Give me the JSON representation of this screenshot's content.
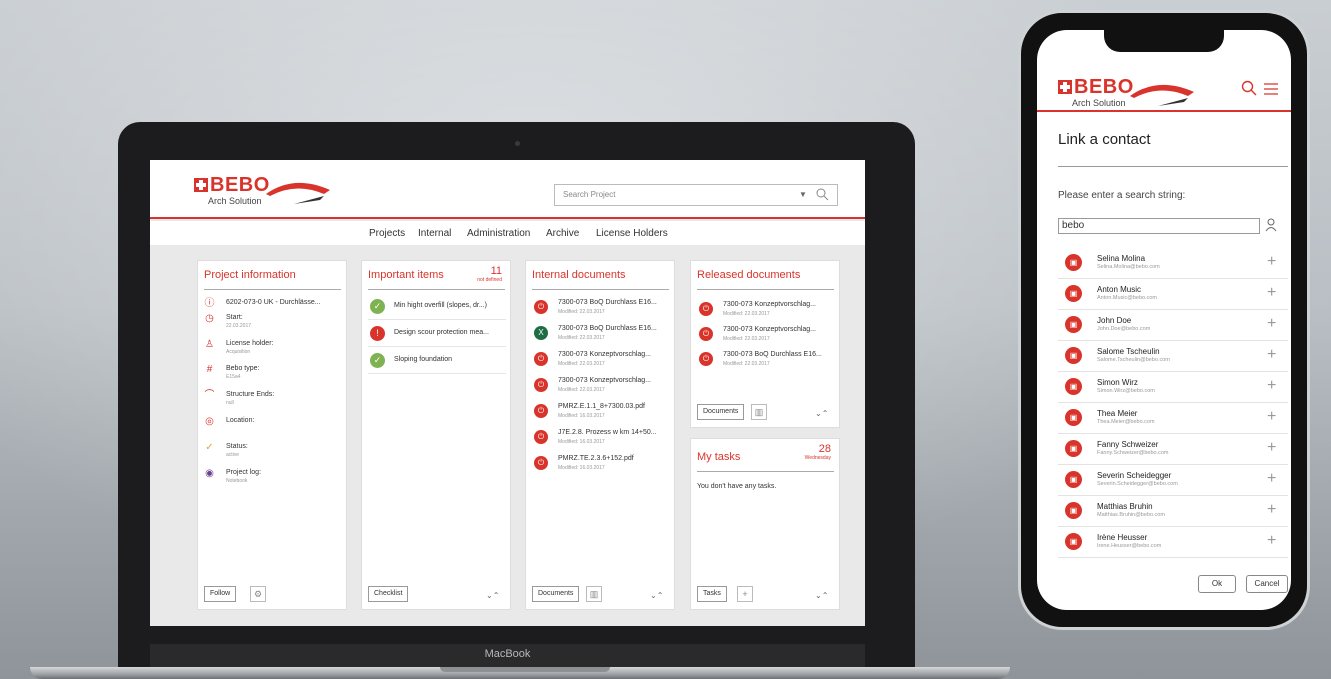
{
  "laptop": {
    "brand": "MacBook",
    "app": {
      "logo_word": "BEBO",
      "logo_sub": "Arch Solution",
      "search_placeholder": "Search Project",
      "nav": [
        "Projects",
        "Internal",
        "Administration",
        "Archive",
        "License Holders"
      ]
    },
    "project_information": {
      "title": "Project information",
      "rows": [
        {
          "icon": "info-icon",
          "label": "6202-073-0 UK - Durchlässe...",
          "sub": ""
        },
        {
          "icon": "clock-icon",
          "label": "Start:",
          "sub": "22.03.2017"
        },
        {
          "icon": "person-icon",
          "label": "License holder:",
          "sub": "Acquisition"
        },
        {
          "icon": "hashtag-icon",
          "label": "Bebo type:",
          "sub": "E15a4"
        },
        {
          "icon": "arch-icon",
          "label": "Structure Ends:",
          "sub": "null"
        },
        {
          "icon": "location-icon",
          "label": "Location:",
          "sub": ""
        },
        {
          "icon": "check-icon",
          "label": "Status:",
          "sub": "active"
        },
        {
          "icon": "log-icon",
          "label": "Project log:",
          "sub": "Notebook"
        }
      ],
      "follow_label": "Follow"
    },
    "important_items": {
      "title": "Important items",
      "count": "11",
      "count_note": "not defined",
      "items": [
        {
          "status": "ok",
          "text": "Min hight overfill (slopes, dr...)"
        },
        {
          "status": "alert",
          "text": "Design scour protection mea..."
        },
        {
          "status": "ok",
          "text": "Sloping foundation"
        }
      ],
      "checklist_label": "Checklist"
    },
    "internal_documents": {
      "title": "Internal documents",
      "docs": [
        {
          "type": "pdf",
          "name": "7300-073 BoQ Durchlass E16...",
          "modified": "Modified: 22.03.2017"
        },
        {
          "type": "xls",
          "name": "7300-073 BoQ Durchlass E16...",
          "modified": "Modified: 22.03.2017"
        },
        {
          "type": "pdf",
          "name": "7300-073 Konzeptvorschlag...",
          "modified": "Modified: 22.03.2017"
        },
        {
          "type": "pdf",
          "name": "7300-073 Konzeptvorschlag...",
          "modified": "Modified: 22.03.2017"
        },
        {
          "type": "pdf",
          "name": "PMRZ.E.1.1_8+7300.03.pdf",
          "modified": "Modified: 16.03.2017"
        },
        {
          "type": "pdf",
          "name": "J7E.2.8. Prozess w km 14+50...",
          "modified": "Modified: 16.03.2017"
        },
        {
          "type": "pdf",
          "name": "PMRZ.TE.2.3.6+152.pdf",
          "modified": "Modified: 16.03.2017"
        }
      ],
      "documents_label": "Documents"
    },
    "released_documents": {
      "title": "Released documents",
      "docs": [
        {
          "type": "pdf",
          "name": "7300-073 Konzeptvorschlag...",
          "modified": "Modified: 22.03.2017"
        },
        {
          "type": "pdf",
          "name": "7300-073 Konzeptvorschlag...",
          "modified": "Modified: 22.03.2017"
        },
        {
          "type": "pdf",
          "name": "7300-073 BoQ Durchlass E16...",
          "modified": "Modified: 22.03.2017"
        }
      ],
      "documents_label": "Documents"
    },
    "my_tasks": {
      "title": "My tasks",
      "day": "28",
      "weekday": "Wednesday",
      "empty_text": "You don't have any tasks.",
      "tasks_label": "Tasks"
    }
  },
  "phone": {
    "logo_word": "BEBO",
    "logo_sub": "Arch Solution",
    "title": "Link a contact",
    "prompt": "Please enter a search string:",
    "search_value": "bebo",
    "contacts": [
      {
        "name": "Selina Molina",
        "email": "Selina.Molina@bebo.com"
      },
      {
        "name": "Anton Music",
        "email": "Anton.Music@bebo.com"
      },
      {
        "name": "John Doe",
        "email": "John.Doe@bebo.com"
      },
      {
        "name": "Salome Tscheulin",
        "email": "Salome.Tscheulin@bebo.com"
      },
      {
        "name": "Simon Wirz",
        "email": "Simon.Wirz@bebo.com"
      },
      {
        "name": "Thea Meier",
        "email": "Thea.Meier@bebo.com"
      },
      {
        "name": "Fanny Schweizer",
        "email": "Fanny.Schweizer@bebo.com"
      },
      {
        "name": "Severin Scheidegger",
        "email": "Severin.Scheidegger@bebo.com"
      },
      {
        "name": "Matthias Bruhin",
        "email": "Matthias.Bruhin@bebo.com"
      },
      {
        "name": "Irène Heusser",
        "email": "Irene.Heusser@bebo.com"
      }
    ],
    "ok_label": "Ok",
    "cancel_label": "Cancel"
  },
  "colors": {
    "accent": "#d9342b",
    "ok": "#7fb351",
    "excel": "#1f6e43"
  }
}
